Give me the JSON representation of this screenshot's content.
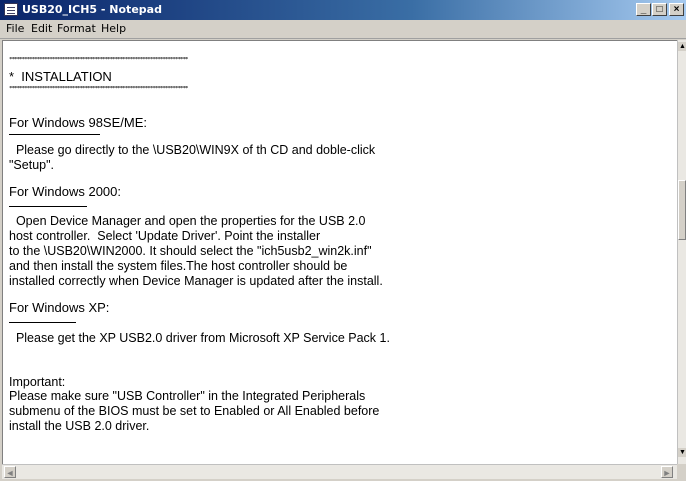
{
  "window": {
    "title": "USB20_ICH5 - Notepad",
    "minimize_glyph": "_",
    "maximize_glyph": "□",
    "close_glyph": "×"
  },
  "menu": [
    "File",
    "Edit",
    "Format",
    "Help"
  ],
  "document": {
    "stars": "***********************************************************************",
    "heading": "*  INSTALLATION",
    "sections": {
      "win98_title": "For Windows 98SE/ME:",
      "win98_body": [
        "  Please go directly to the \\USB20\\WIN9X of th CD and doble-click",
        "\"Setup\"."
      ],
      "win2000_title": "For Windows 2000:",
      "win2000_body": [
        "  Open Device Manager and open the properties for the USB 2.0",
        "host controller.  Select 'Update Driver'. Point the installer",
        "to the \\USB20\\WIN2000. It should select the \"ich5usb2_win2k.inf\"",
        "and then install the system files.The host controller should be",
        "installed correctly when Device Manager is updated after the install."
      ],
      "winxp_title": "For Windows XP:",
      "winxp_body": [
        "  Please get the XP USB2.0 driver from Microsoft XP Service Pack 1."
      ],
      "important_title": "Important:",
      "important_body": [
        "Please make sure \"USB Controller\" in the Integrated Peripherals",
        "submenu of the BIOS must be set to Enabled or All Enabled before",
        "install the USB 2.0 driver."
      ]
    }
  },
  "scrollbars": {
    "up_arrow": "▲",
    "down_arrow": "▼",
    "left_arrow": "◄",
    "right_arrow": "►"
  }
}
